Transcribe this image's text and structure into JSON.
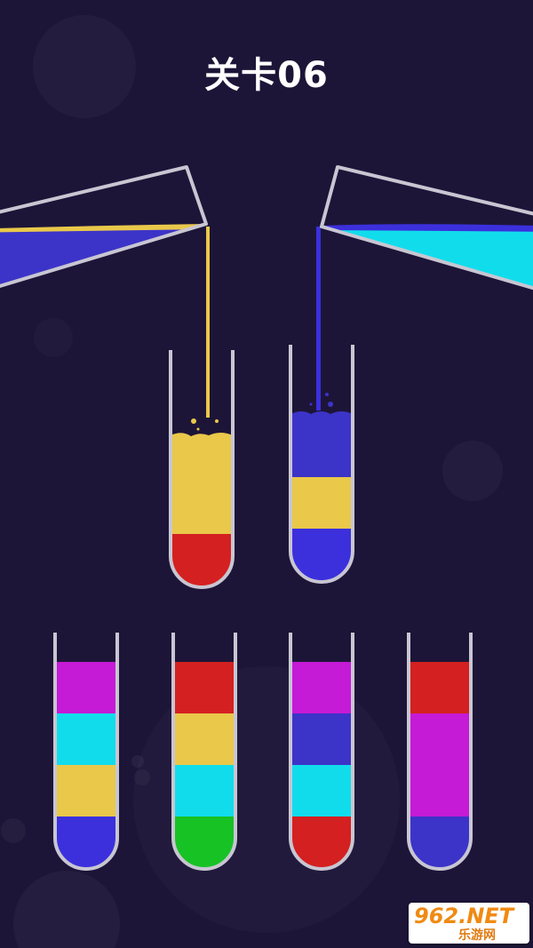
{
  "level": {
    "title": "关卡06"
  },
  "colors": {
    "background": "#1d1538",
    "red": "#d42020",
    "yellow": "#e9c84a",
    "cyan": "#11dcec",
    "magenta": "#c51ad6",
    "blue": "#3b30dc",
    "indigo": "#3c34c8",
    "green": "#17c225",
    "tube_outline": "#c8c6d2"
  },
  "tubes": [
    {
      "id": "tube-1",
      "layers": [
        "blue",
        "yellow",
        "cyan",
        "magenta"
      ]
    },
    {
      "id": "tube-2",
      "layers": [
        "green",
        "cyan",
        "yellow",
        "red"
      ]
    },
    {
      "id": "tube-3",
      "layers": [
        "red",
        "cyan",
        "indigo",
        "magenta"
      ]
    },
    {
      "id": "tube-4",
      "layers": [
        "indigo",
        "magenta",
        "magenta",
        "red"
      ]
    },
    {
      "id": "tube-receiving-left",
      "layers": [
        "red",
        "yellow"
      ]
    },
    {
      "id": "tube-receiving-right",
      "layers": [
        "blue",
        "yellow",
        "blue"
      ]
    }
  ],
  "pouring_tubes": [
    {
      "id": "pour-left",
      "liquid": "indigo",
      "stream": "yellow"
    },
    {
      "id": "pour-right",
      "liquid": "cyan",
      "stream": "blue"
    }
  ],
  "watermark": {
    "main": "962.NET",
    "sub": "乐游网"
  }
}
